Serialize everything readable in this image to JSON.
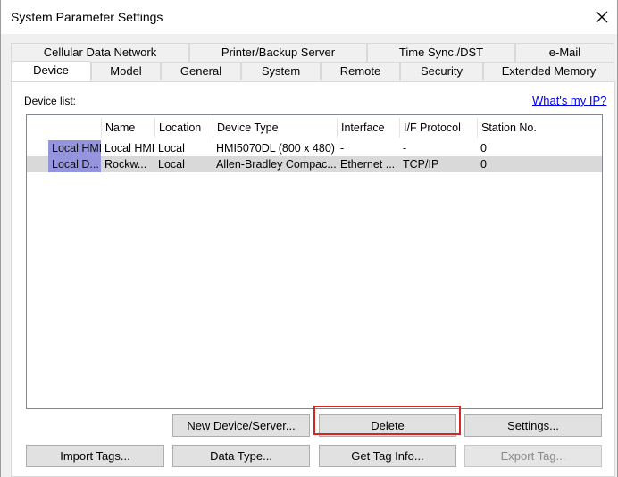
{
  "window": {
    "title": "System Parameter Settings"
  },
  "tabs_row1": [
    "Cellular Data Network",
    "Printer/Backup Server",
    "Time Sync./DST",
    "e-Mail"
  ],
  "tabs_row2": [
    "Device",
    "Model",
    "General",
    "System",
    "Remote",
    "Security",
    "Extended Memory"
  ],
  "active_tab": "Device",
  "device_list": {
    "label": "Device list:",
    "help_link": "What's my IP?",
    "columns": [
      "Name",
      "Location",
      "Device Type",
      "Interface",
      "I/F Protocol",
      "Station No."
    ],
    "rows": [
      {
        "header": "Local HMI",
        "name": "Local HMI",
        "location": "Local",
        "device_type": "HMI5070DL (800 x 480)",
        "interface": "-",
        "protocol": "-",
        "station": "0",
        "selected": false
      },
      {
        "header": "Local D...",
        "name": "Rockw...",
        "location": "Local",
        "device_type": "Allen-Bradley Compac...",
        "interface": "Ethernet ...",
        "protocol": "TCP/IP",
        "station": "0",
        "selected": true
      }
    ]
  },
  "buttons": {
    "new_device": "New Device/Server...",
    "delete": "Delete",
    "settings": "Settings...",
    "import_tags": "Import Tags...",
    "data_type": "Data Type...",
    "get_tag_info": "Get Tag Info...",
    "export_tag": "Export Tag..."
  },
  "colors": {
    "row_header": "#9595dd",
    "selection": "#d9d9d9",
    "highlight_box": "#d32626",
    "link": "#0000ee"
  }
}
